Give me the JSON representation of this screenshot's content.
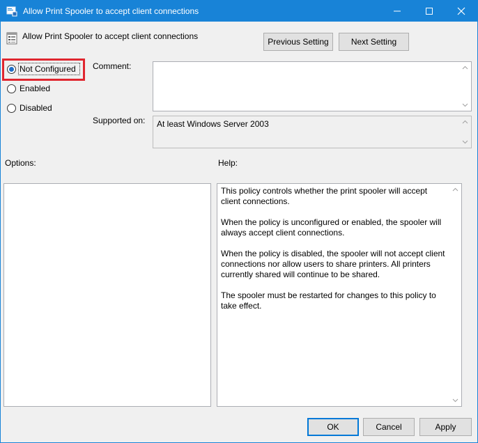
{
  "window": {
    "title": "Allow Print Spooler to accept client connections",
    "accent": "#1883d7"
  },
  "header": {
    "policy_name": "Allow Print Spooler to accept client connections"
  },
  "nav": {
    "previous_label": "Previous Setting",
    "next_label": "Next Setting"
  },
  "state": {
    "options": [
      {
        "label": "Not Configured",
        "checked": true
      },
      {
        "label": "Enabled",
        "checked": false
      },
      {
        "label": "Disabled",
        "checked": false
      }
    ],
    "highlight_color": "#e0262f"
  },
  "comment": {
    "label": "Comment:",
    "value": ""
  },
  "supported": {
    "label": "Supported on:",
    "value": "At least Windows Server 2003"
  },
  "options_panel": {
    "label": "Options:"
  },
  "help_panel": {
    "label": "Help:",
    "paragraphs": [
      "This policy controls whether the print spooler will accept client connections.",
      "When the policy is unconfigured or enabled, the spooler will always accept client connections.",
      "When the policy is disabled, the spooler will not accept client connections nor allow users to share printers.  All printers currently shared will continue to be shared.",
      "The spooler must be restarted for changes to this policy to take effect."
    ]
  },
  "footer": {
    "ok_label": "OK",
    "cancel_label": "Cancel",
    "apply_label": "Apply"
  }
}
